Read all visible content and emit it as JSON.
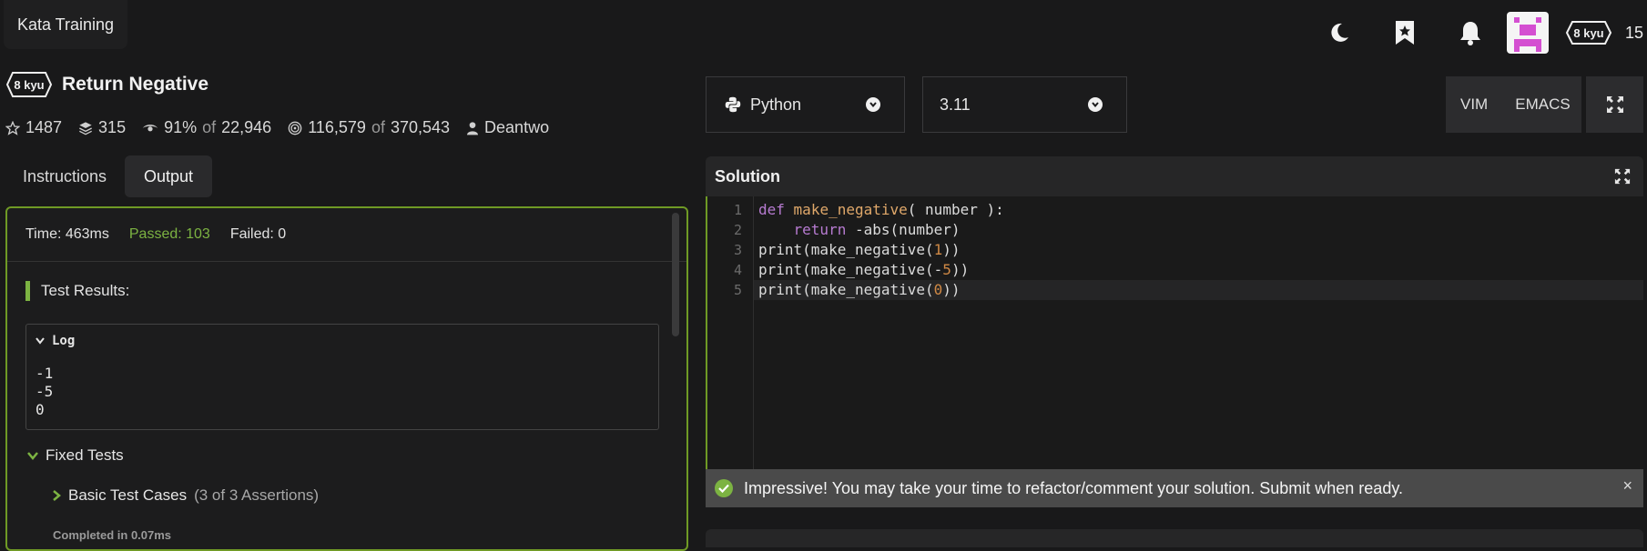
{
  "app": {
    "brand": "Kata Training"
  },
  "header": {
    "icons": [
      "moon-icon",
      "bookmark-star-icon",
      "bell-icon"
    ],
    "rank": "8 kyu",
    "honor": "15"
  },
  "kata": {
    "rank": "8 kyu",
    "title": "Return Negative",
    "stats": {
      "stars": "1487",
      "collections": "315",
      "satisfaction_pct": "91%",
      "satisfaction_of_label": "of",
      "satisfaction_votes": "22,946",
      "completed": "116,579",
      "attempts_of_label": "of",
      "attempts": "370,543",
      "author": "Deantwo"
    }
  },
  "tabs": [
    {
      "label": "Instructions",
      "active": false
    },
    {
      "label": "Output",
      "active": true
    }
  ],
  "output": {
    "time": "Time: 463ms",
    "passed": "Passed: 103",
    "failed": "Failed: 0",
    "results_title": "Test Results:",
    "log": {
      "title": "Log",
      "lines": [
        "-1",
        "-5",
        "0"
      ]
    },
    "fixed_tests_label": "Fixed Tests",
    "basic_test_label": "Basic Test Cases",
    "basic_test_count": "(3 of 3 Assertions)",
    "completed": "Completed in 0.07ms"
  },
  "language_select": {
    "value": "Python"
  },
  "version_select": {
    "value": "3.11"
  },
  "modes": {
    "vim": "VIM",
    "emacs": "EMACS"
  },
  "solution": {
    "title": "Solution",
    "line_numbers": [
      "1",
      "2",
      "3",
      "4",
      "5"
    ],
    "notification": "Impressive! You may take your time to refactor/comment your solution. Submit when ready.",
    "close": "×"
  },
  "colors": {
    "accent_green": "#7cb342",
    "panel_border": "#6f9a25",
    "background": "#19191a"
  }
}
